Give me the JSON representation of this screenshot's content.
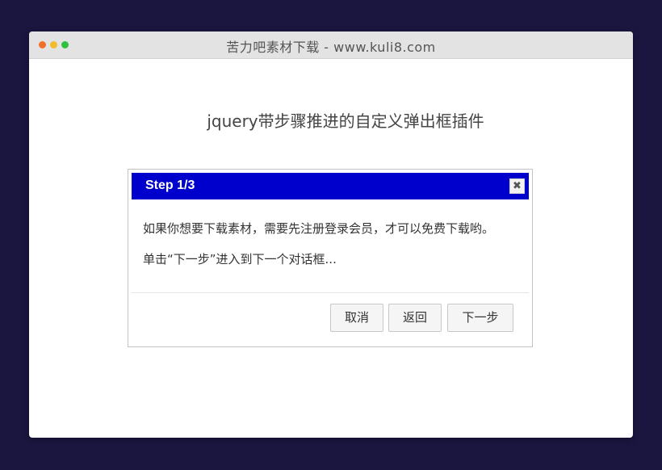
{
  "window": {
    "title": "苦力吧素材下载 - www.kuli8.com",
    "dots": [
      "red",
      "yellow",
      "green"
    ]
  },
  "page": {
    "heading": "jquery带步骤推进的自定义弹出框插件"
  },
  "dialog": {
    "title": "Step 1/3",
    "close_label": "✖",
    "body": [
      "如果你想要下载素材，需要先注册登录会员，才可以免费下载哟。",
      "单击“下一步”进入到下一个对话框..."
    ],
    "buttons": {
      "cancel": "取消",
      "back": "返回",
      "next": "下一步"
    }
  },
  "colors": {
    "background": "#1a1640",
    "dialog_header": "#0000cc",
    "dot_red": "#f0702a",
    "dot_yellow": "#f2bd2c",
    "dot_green": "#2fc040"
  },
  "icons": {
    "close": "close-icon"
  }
}
